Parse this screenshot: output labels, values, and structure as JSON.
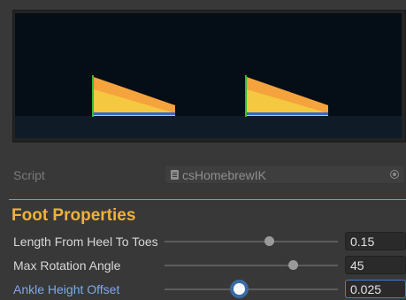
{
  "inspector": {
    "script_label": "Script",
    "script_value": "csHomebrewIK",
    "section_title": "Foot Properties",
    "properties": [
      {
        "label": "Length From Heel To Toes",
        "value": "0.15",
        "slider_fraction": 0.6,
        "focused": false
      },
      {
        "label": "Max Rotation Angle",
        "value": "45",
        "slider_fraction": 0.74,
        "focused": false
      },
      {
        "label": "Ankle Height Offset",
        "value": "0.025",
        "slider_fraction": 0.43,
        "focused": true
      }
    ]
  },
  "colors": {
    "accent_orange": "#f0b13a",
    "focus_blue": "#3f7fd4",
    "foot_orange": "#f5a33c",
    "foot_yellow": "#f5c842",
    "foot_green": "#33bb33",
    "foot_blue": "#3a66c8"
  },
  "icons": {
    "script": "script-file-icon",
    "picker": "object-picker-target-icon"
  }
}
